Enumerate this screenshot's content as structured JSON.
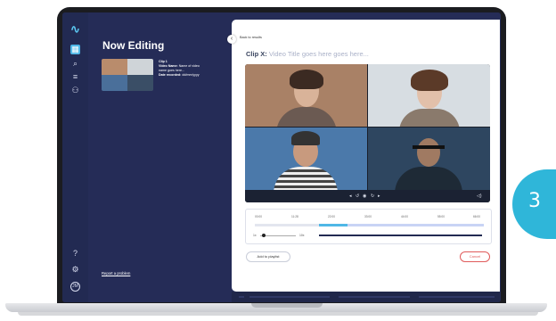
{
  "sidebar": {
    "help_icon": "?",
    "settings_icon": "⚙",
    "avatar_text": "JM"
  },
  "editing": {
    "title": "Now Editing",
    "clip_name": "Clip 1",
    "video_name_label": "Video Name:",
    "video_name_value": "Name of video",
    "video_name_cont": "name goes here...",
    "date_label": "Date recorded:",
    "date_value": "dd/mm/yyyy"
  },
  "footer": {
    "report_link": "Report a problem"
  },
  "panel": {
    "back_label": "Back to results",
    "clip_prefix": "Clip X:",
    "clip_title": "Video Title goes here goes here..."
  },
  "timeline": {
    "ticks": [
      "00:00",
      "11:28",
      "22:00",
      "33:00",
      "44:00",
      "55:00",
      "66:00"
    ],
    "zoom_min": "1x",
    "zoom_max": "10x"
  },
  "actions": {
    "add_label": "Add to playlist",
    "cancel_label": "Cancel"
  },
  "badge": {
    "number": "3"
  },
  "colors": {
    "navy": "#252c57",
    "accent": "#4fb7e6",
    "cancel": "#e05a5a",
    "badge": "#2fb6d9"
  }
}
